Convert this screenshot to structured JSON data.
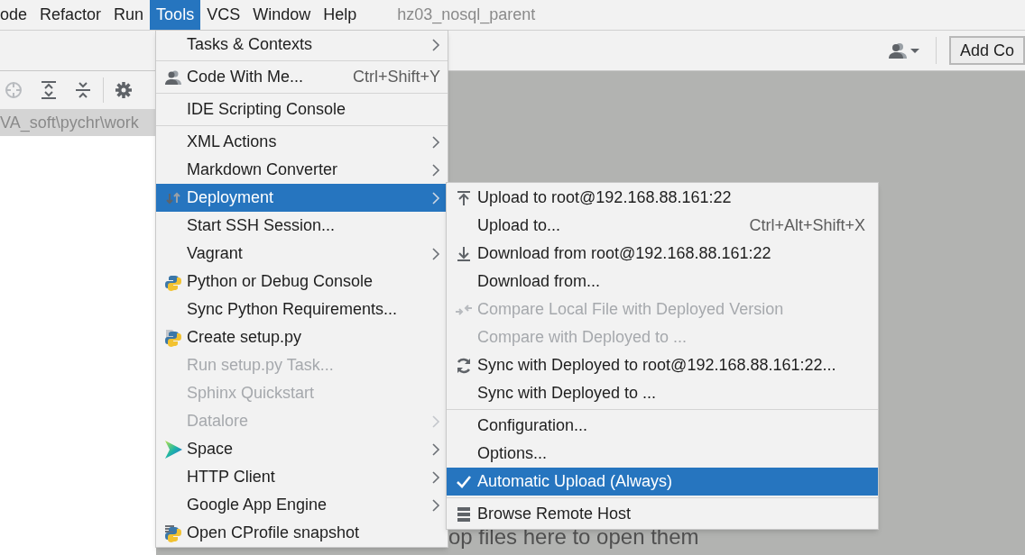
{
  "menu_bar": [
    {
      "label": "ode",
      "selected": false
    },
    {
      "label": "Refactor",
      "selected": false
    },
    {
      "label": "Run",
      "selected": false
    },
    {
      "label": "Tools",
      "selected": true
    },
    {
      "label": "VCS",
      "selected": false
    },
    {
      "label": "Window",
      "selected": false
    },
    {
      "label": "Help",
      "selected": false
    }
  ],
  "window": {
    "title": "hz03_nosql_parent"
  },
  "project_path": "VA_soft\\pychr\\work",
  "toolbar": {
    "add_button": "Add Co"
  },
  "editor": {
    "hint": "op files here to open them"
  },
  "tools_menu": [
    {
      "kind": "item",
      "label": "Tasks & Contexts",
      "submenu": true,
      "disabled": false,
      "selected": false
    },
    {
      "kind": "separator"
    },
    {
      "kind": "item",
      "label": "Code With Me...",
      "shortcut": "Ctrl+Shift+Y",
      "submenu": false,
      "disabled": false,
      "selected": false
    },
    {
      "kind": "separator"
    },
    {
      "kind": "item",
      "label": "IDE Scripting Console",
      "submenu": false,
      "disabled": false,
      "selected": false
    },
    {
      "kind": "separator"
    },
    {
      "kind": "item",
      "label": "XML Actions",
      "submenu": true,
      "disabled": false,
      "selected": false
    },
    {
      "kind": "item",
      "label": "Markdown Converter",
      "submenu": true,
      "disabled": false,
      "selected": false
    },
    {
      "kind": "item",
      "label": "Deployment",
      "submenu": true,
      "disabled": false,
      "selected": true
    },
    {
      "kind": "item",
      "label": "Start SSH Session...",
      "submenu": false,
      "disabled": false,
      "selected": false
    },
    {
      "kind": "item",
      "label": "Vagrant",
      "submenu": true,
      "disabled": false,
      "selected": false
    },
    {
      "kind": "item",
      "label": "Python or Debug Console",
      "submenu": false,
      "disabled": false,
      "selected": false
    },
    {
      "kind": "item",
      "label": "Sync Python Requirements...",
      "submenu": false,
      "disabled": false,
      "selected": false
    },
    {
      "kind": "item",
      "label": "Create setup.py",
      "submenu": false,
      "disabled": false,
      "selected": false
    },
    {
      "kind": "item",
      "label": "Run setup.py Task...",
      "submenu": false,
      "disabled": true,
      "selected": false
    },
    {
      "kind": "item",
      "label": "Sphinx Quickstart",
      "submenu": false,
      "disabled": true,
      "selected": false
    },
    {
      "kind": "item",
      "label": "Datalore",
      "submenu": true,
      "disabled": true,
      "selected": false
    },
    {
      "kind": "item",
      "label": "Space",
      "submenu": true,
      "disabled": false,
      "selected": false
    },
    {
      "kind": "item",
      "label": "HTTP Client",
      "submenu": true,
      "disabled": false,
      "selected": false
    },
    {
      "kind": "item",
      "label": "Google App Engine",
      "submenu": true,
      "disabled": false,
      "selected": false
    },
    {
      "kind": "item",
      "label": "Open CProfile snapshot",
      "submenu": false,
      "disabled": false,
      "selected": false
    }
  ],
  "deployment_menu": [
    {
      "kind": "item",
      "label": "Upload to root@192.168.88.161:22",
      "disabled": false,
      "selected": false,
      "checked": false
    },
    {
      "kind": "item",
      "label": "Upload to...",
      "shortcut": "Ctrl+Alt+Shift+X",
      "disabled": false,
      "selected": false,
      "checked": false
    },
    {
      "kind": "item",
      "label": "Download from root@192.168.88.161:22",
      "disabled": false,
      "selected": false,
      "checked": false
    },
    {
      "kind": "item",
      "label": "Download from...",
      "disabled": false,
      "selected": false,
      "checked": false
    },
    {
      "kind": "item",
      "label": "Compare Local File with Deployed Version",
      "disabled": true,
      "selected": false,
      "checked": false
    },
    {
      "kind": "item",
      "label": "Compare with Deployed to ...",
      "disabled": true,
      "selected": false,
      "checked": false
    },
    {
      "kind": "item",
      "label": "Sync with Deployed to root@192.168.88.161:22...",
      "disabled": false,
      "selected": false,
      "checked": false
    },
    {
      "kind": "item",
      "label": "Sync with Deployed to ...",
      "disabled": false,
      "selected": false,
      "checked": false
    },
    {
      "kind": "separator"
    },
    {
      "kind": "item",
      "label": "Configuration...",
      "disabled": false,
      "selected": false,
      "checked": false
    },
    {
      "kind": "item",
      "label": "Options...",
      "disabled": false,
      "selected": false,
      "checked": false
    },
    {
      "kind": "item",
      "label": "Automatic Upload (Always)",
      "disabled": false,
      "selected": true,
      "checked": true
    },
    {
      "kind": "separator"
    },
    {
      "kind": "item",
      "label": "Browse Remote Host",
      "disabled": false,
      "selected": false,
      "checked": false
    }
  ]
}
